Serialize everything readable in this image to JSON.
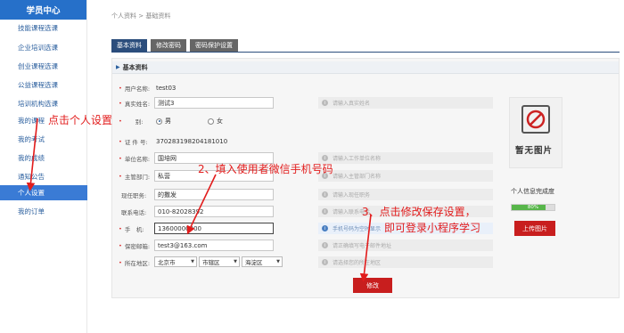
{
  "sidebar": {
    "title": "学员中心",
    "items": [
      {
        "label": "技能课程选课"
      },
      {
        "label": "企业培训选课"
      },
      {
        "label": "创业课程选课"
      },
      {
        "label": "公益课程选课"
      },
      {
        "label": "培训机构选课"
      },
      {
        "label": "我的课程"
      },
      {
        "label": "我的考试"
      },
      {
        "label": "我的成绩"
      },
      {
        "label": "通知公告"
      },
      {
        "label": "个人设置",
        "active": true
      },
      {
        "label": "我的订单"
      }
    ]
  },
  "breadcrumb": "个人资料 > 基础资料",
  "tabs": [
    {
      "label": "基本资料",
      "active": true
    },
    {
      "label": "修改密码"
    },
    {
      "label": "密码保护设置"
    }
  ],
  "section_title": "基本资料",
  "form": {
    "username": {
      "label": "用户名称:",
      "value": "test03"
    },
    "realname": {
      "label": "真实姓名:",
      "value": "测试3",
      "hint": "请输入真实姓名"
    },
    "gender": {
      "label": "别:",
      "options": [
        "男",
        "女"
      ],
      "selected": "男"
    },
    "idcard": {
      "label": "证 件 号:",
      "value": "370283198204181010"
    },
    "company": {
      "label": "单位名称:",
      "value": "国培网",
      "hint": "请输入工作单位名称"
    },
    "department": {
      "label": "主管部门:",
      "value": "私营",
      "hint": "请输入主管部门名称"
    },
    "position": {
      "label": "现任职务:",
      "value": "的撒发",
      "hint": "请输入现任职务"
    },
    "phone": {
      "label": "联系电话:",
      "value": "010-82028392",
      "hint": "请输入联系电话"
    },
    "mobile": {
      "label": "手　机:",
      "value": "13600000000",
      "hint": "手机号码为空时显示"
    },
    "email": {
      "label": "保密邮箱:",
      "value": "test3@163.com",
      "hint": "请正确填写电子邮件地址"
    },
    "region": {
      "label": "所在地区:",
      "province": "北京市",
      "district": "市辖区",
      "county": "海淀区",
      "hint": "请选择您的所在地区"
    },
    "submit_label": "修改"
  },
  "avatar": {
    "placeholder_text": "暂无图片",
    "complete_label": "个人信息完成度",
    "progress_percent": 80,
    "progress_text": "80%",
    "upload_label": "上传图片"
  },
  "annotations": {
    "step1": "点击个人设置",
    "step2": "2、填入使用者微信手机号码",
    "step3_line1": "3、点击修改保存设置，",
    "step3_line2": "即可登录小程序学习"
  },
  "colors": {
    "brand_blue": "#2670c9",
    "nav_dark": "#2b4d7c",
    "action_red": "#c81e1e",
    "annotation_red": "#e21c1c",
    "progress_green": "#57b64a"
  }
}
